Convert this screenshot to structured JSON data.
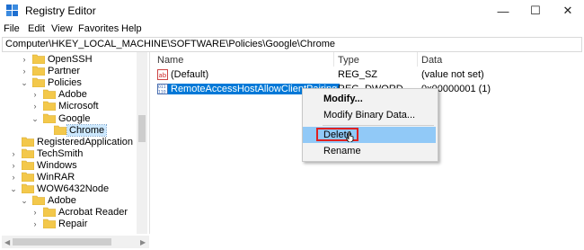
{
  "window": {
    "title": "Registry Editor",
    "minimize": "—",
    "maximize": "☐",
    "close": "✕"
  },
  "menu": [
    "File",
    "Edit",
    "View",
    "Favorites",
    "Help"
  ],
  "address": "Computer\\HKEY_LOCAL_MACHINE\\SOFTWARE\\Policies\\Google\\Chrome",
  "tree": [
    {
      "label": "OpenSSH",
      "level": 2,
      "expander": "›"
    },
    {
      "label": "Partner",
      "level": 2,
      "expander": "›"
    },
    {
      "label": "Policies",
      "level": 2,
      "expander": "⌄"
    },
    {
      "label": "Adobe",
      "level": 3,
      "expander": "›"
    },
    {
      "label": "Microsoft",
      "level": 3,
      "expander": "›"
    },
    {
      "label": "Google",
      "level": 3,
      "expander": "⌄"
    },
    {
      "label": "Chrome",
      "level": 4,
      "expander": "",
      "selected": true
    },
    {
      "label": "RegisteredApplication",
      "level": 1,
      "expander": ""
    },
    {
      "label": "TechSmith",
      "level": 1,
      "expander": "›"
    },
    {
      "label": "Windows",
      "level": 1,
      "expander": "›"
    },
    {
      "label": "WinRAR",
      "level": 1,
      "expander": "›"
    },
    {
      "label": "WOW6432Node",
      "level": 1,
      "expander": "⌄"
    },
    {
      "label": "Adobe",
      "level": 2,
      "expander": "⌄"
    },
    {
      "label": "Acrobat Reader",
      "level": 3,
      "expander": "›"
    },
    {
      "label": "Repair",
      "level": 3,
      "expander": "›"
    }
  ],
  "columns": {
    "name": "Name",
    "type": "Type",
    "data": "Data"
  },
  "values": [
    {
      "name": "(Default)",
      "type": "REG_SZ",
      "data": "(value not set)",
      "icon": "string-value-icon"
    },
    {
      "name": "RemoteAccessHostAllowClientPairing",
      "type": "REG_DWORD",
      "data": "0x00000001 (1)",
      "icon": "binary-value-icon",
      "selected": true
    }
  ],
  "context_menu": {
    "modify": "Modify...",
    "modify_binary": "Modify Binary Data...",
    "delete": "Delete",
    "rename": "Rename"
  },
  "colors": {
    "selection": "#0078d7",
    "highlight": "#91c9f7",
    "annotation": "#e02020",
    "folder": "#f3c84b"
  }
}
